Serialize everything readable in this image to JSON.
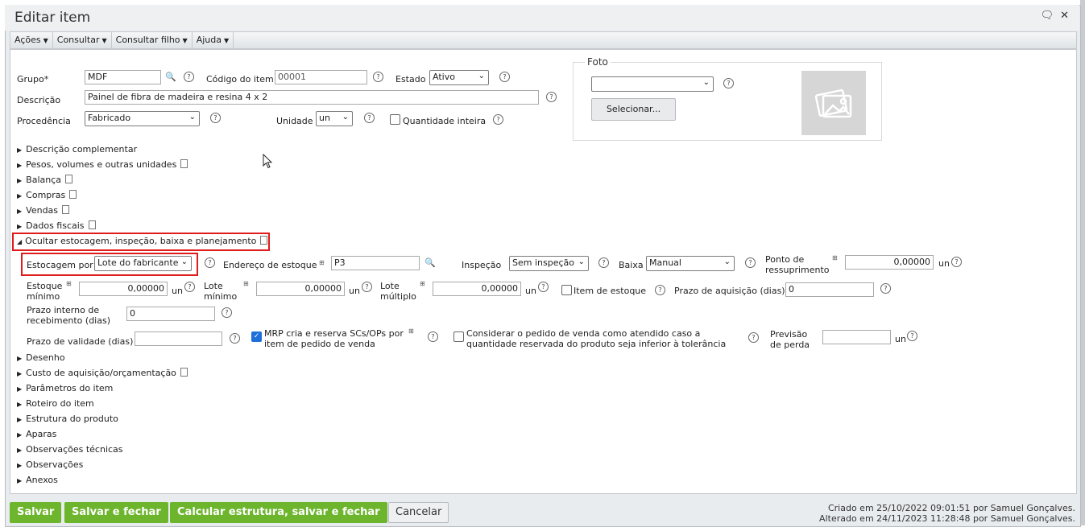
{
  "window": {
    "title": "Editar item"
  },
  "menu": [
    {
      "label": "Ações"
    },
    {
      "label": "Consultar"
    },
    {
      "label": "Consultar filho"
    },
    {
      "label": "Ajuda"
    }
  ],
  "form": {
    "grupo_label": "Grupo*",
    "grupo_value": "MDF",
    "codigo_label": "Código do item",
    "codigo_value": "00001",
    "estado_label": "Estado",
    "estado_value": "Ativo",
    "descricao_label": "Descrição",
    "descricao_value": "Painel de fibra de madeira e resina 4 x 2",
    "procedencia_label": "Procedência",
    "procedencia_value": "Fabricado",
    "unidade_label": "Unidade",
    "unidade_value": "un",
    "qtd_inteira_label": "Quantidade inteira"
  },
  "foto": {
    "legend": "Foto",
    "select_value": "",
    "button_label": "Selecionar..."
  },
  "sections_top": [
    {
      "label": "Descrição complementar",
      "doc": false
    },
    {
      "label": "Pesos, volumes e outras unidades",
      "doc": true
    },
    {
      "label": "Balança",
      "doc": true
    },
    {
      "label": "Compras",
      "doc": true
    },
    {
      "label": "Vendas",
      "doc": true
    },
    {
      "label": "Dados fiscais",
      "doc": true
    }
  ],
  "expanded_section": {
    "label": "Ocultar estocagem, inspeção, baixa e planejamento"
  },
  "estoque": {
    "estocagem_label": "Estocagem por",
    "estocagem_value": "Lote do fabricante",
    "endereco_label": "Endereço de estoque",
    "endereco_value": "P3",
    "inspecao_label": "Inspeção",
    "inspecao_value": "Sem inspeção",
    "baixa_label": "Baixa",
    "baixa_value": "Manual",
    "ponto_label_1": "Ponto de",
    "ponto_label_2": "ressuprimento",
    "ponto_value": "0,00000",
    "unit": "un",
    "estoque_min_label_1": "Estoque",
    "estoque_min_label_2": "mínimo",
    "estoque_min_value": "0,00000",
    "lote_min_label_1": "Lote",
    "lote_min_label_2": "mínimo",
    "lote_min_value": "0,00000",
    "lote_mult_label_1": "Lote",
    "lote_mult_label_2": "múltiplo",
    "lote_mult_value": "0,00000",
    "item_estoque_label": "Item de estoque",
    "prazo_aquis_label": "Prazo de aquisição (dias)",
    "prazo_aquis_value": "0",
    "prazo_interno_label_1": "Prazo interno de",
    "prazo_interno_label_2": "recebimento (dias)",
    "prazo_interno_value": "0",
    "prazo_validade_label": "Prazo de validade (dias)",
    "prazo_validade_value": "",
    "mrp_label_1": "MRP cria e reserva SCs/OPs por",
    "mrp_label_2": "item de pedido de venda",
    "considerar_label_1": "Considerar o pedido de venda como atendido caso a",
    "considerar_label_2": "quantidade reservada do produto seja inferior à tolerância",
    "previsao_label_1": "Previsão",
    "previsao_label_2": "de perda",
    "previsao_value": ""
  },
  "sections_bottom": [
    {
      "label": "Desenho",
      "doc": false
    },
    {
      "label": "Custo de aquisição/orçamentação",
      "doc": true
    },
    {
      "label": "Parâmetros do item",
      "doc": false
    },
    {
      "label": "Roteiro do item",
      "doc": false
    },
    {
      "label": "Estrutura do produto",
      "doc": false
    },
    {
      "label": "Aparas",
      "doc": false
    },
    {
      "label": "Observações técnicas",
      "doc": false
    },
    {
      "label": "Observações",
      "doc": false
    },
    {
      "label": "Anexos",
      "doc": false
    }
  ],
  "footer": {
    "salvar": "Salvar",
    "salvar_fechar": "Salvar e fechar",
    "calcular": "Calcular estrutura, salvar e fechar",
    "cancelar": "Cancelar",
    "criado": "Criado em 25/10/2022 09:01:51 por Samuel Gonçalves.",
    "alterado": "Alterado em 24/11/2023 11:28:48 por Samuel Gonçalves."
  }
}
